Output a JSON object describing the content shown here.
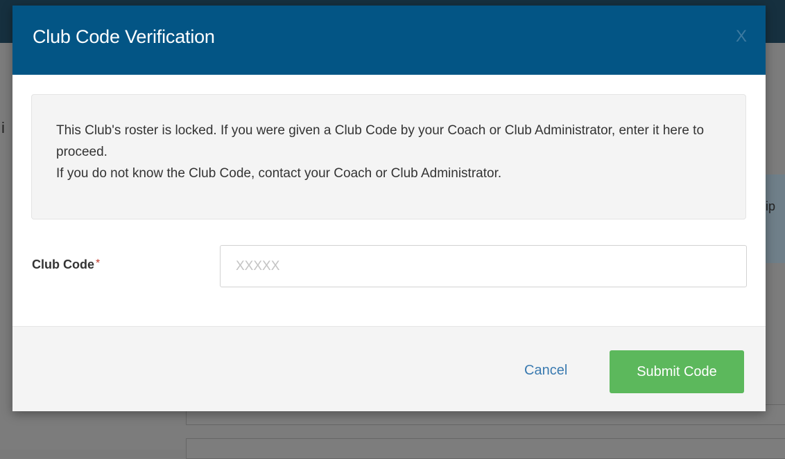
{
  "modal": {
    "title": "Club Code Verification",
    "close_label": "X",
    "info": {
      "line1": "This Club's roster is locked. If you were given a Club Code by your Coach or Club Administrator, enter it here to proceed.",
      "line2": "If you do not know the Club Code, contact your Coach or Club Administrator."
    },
    "field": {
      "label": "Club Code",
      "required_marker": "*",
      "placeholder": "XXXXX",
      "value": ""
    },
    "footer": {
      "cancel_label": "Cancel",
      "submit_label": "Submit Code"
    }
  },
  "background": {
    "fragment_left_1": "i",
    "fragment_right_1": "ip"
  },
  "colors": {
    "header_bg": "#035585",
    "submit_bg": "#5cb85c",
    "cancel_link": "#3a7ab0",
    "required_star": "#c0392b"
  },
  "icons": {
    "close": "close-icon"
  }
}
